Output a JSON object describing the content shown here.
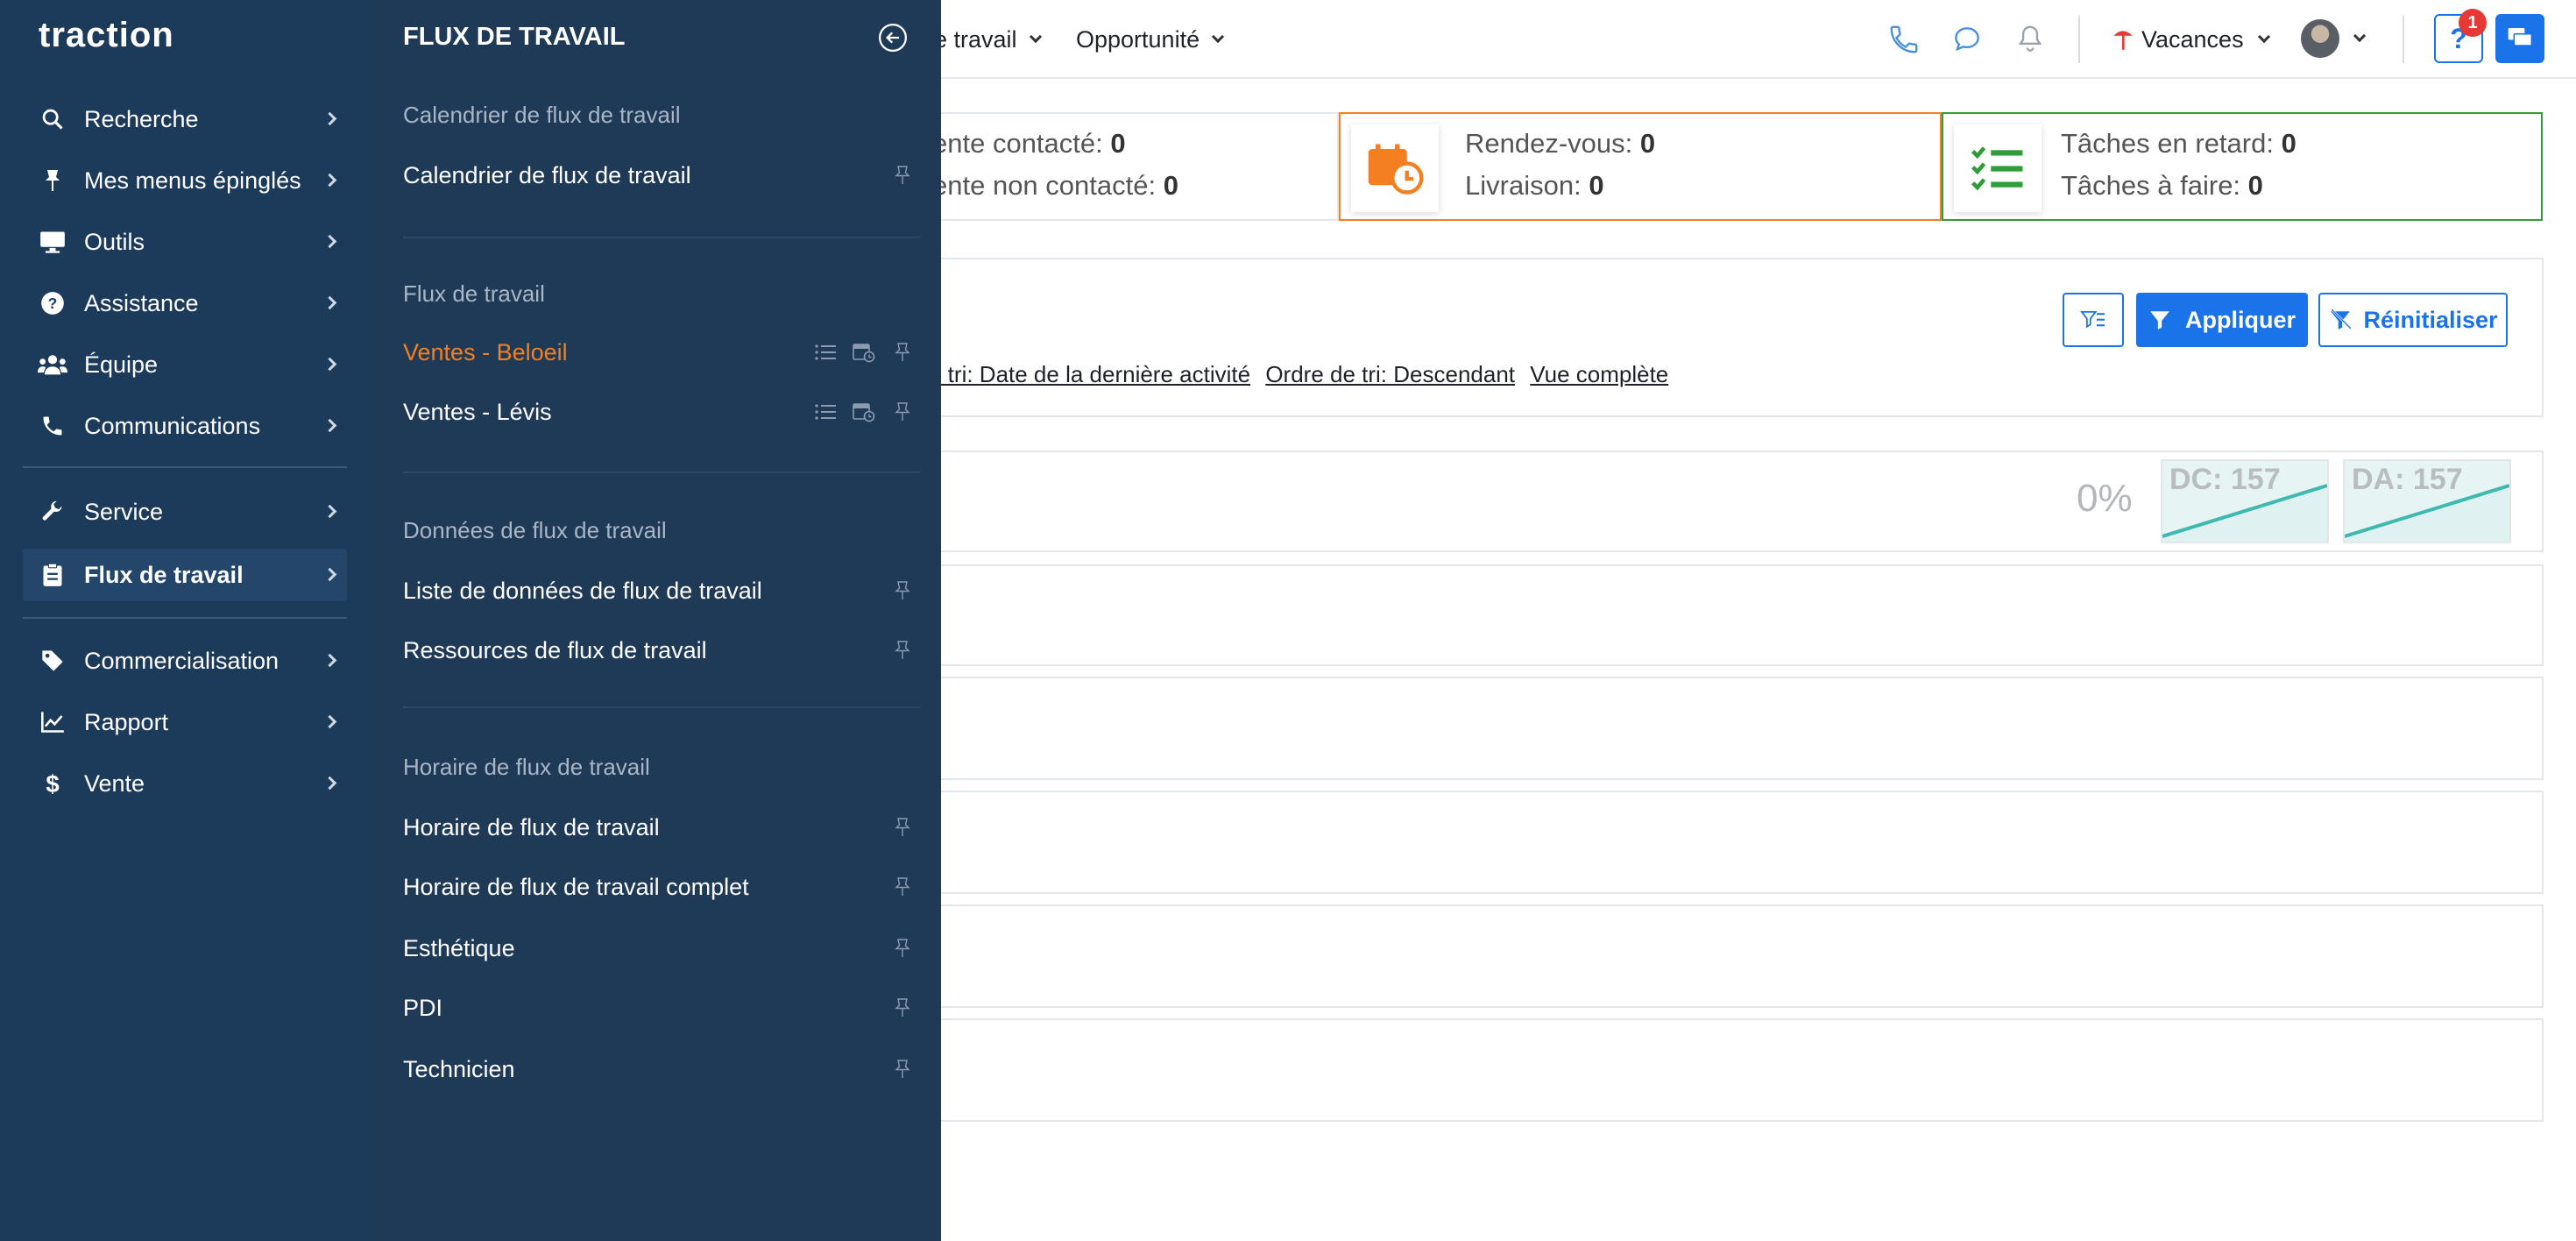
{
  "brand": {
    "logo_text": "traction"
  },
  "topbar": {
    "nav": [
      {
        "label": "e travail"
      },
      {
        "label": "Opportunité"
      }
    ],
    "vacances_label": "Vacances",
    "help_badge_count": "1",
    "help_label": "?"
  },
  "stats": {
    "card1": {
      "line1_label": "ente contacté:",
      "line1_value": "0",
      "line2_label": "ente non contacté:",
      "line2_value": "0"
    },
    "card2": {
      "line1_label": "Rendez-vous:",
      "line1_value": "0",
      "line2_label": "Livraison:",
      "line2_value": "0",
      "accent": "#f47f20"
    },
    "card3": {
      "line1_label": "Tâches en retard:",
      "line1_value": "0",
      "line2_label": "Tâches à faire:",
      "line2_value": "0",
      "accent": "#2e9d3a"
    }
  },
  "filters": {
    "apply_label": "Appliquer",
    "reset_label": "Réinitialiser",
    "sort_field_link": "e tri: Date de la dernière activité",
    "sort_order_link": "Ordre de tri: Descendant",
    "view_link": "Vue complète"
  },
  "summary": {
    "percent": "0%",
    "dc_label": "DC: 157",
    "da_label": "DA: 157"
  },
  "sidebar": {
    "items": [
      {
        "label": "Recherche",
        "icon": "search-icon"
      },
      {
        "label": "Mes menus épinglés",
        "icon": "pin-icon"
      },
      {
        "label": "Outils",
        "icon": "monitor-icon"
      },
      {
        "label": "Assistance",
        "icon": "help-circle-icon"
      },
      {
        "label": "Équipe",
        "icon": "users-icon"
      },
      {
        "label": "Communications",
        "icon": "phone-icon"
      },
      {
        "label": "Service",
        "icon": "wrench-icon"
      },
      {
        "label": "Flux de travail",
        "icon": "clipboard-icon",
        "active": true
      },
      {
        "label": "Commercialisation",
        "icon": "tag-icon"
      },
      {
        "label": "Rapport",
        "icon": "chart-line-icon"
      },
      {
        "label": "Vente",
        "icon": "dollar-icon"
      }
    ]
  },
  "panel": {
    "title": "FLUX DE TRAVAIL",
    "sections": [
      {
        "header": "Calendrier de flux de travail",
        "items": [
          {
            "label": "Calendrier de flux de travail"
          }
        ]
      },
      {
        "header": "Flux de travail",
        "items": [
          {
            "label": "Ventes - Beloeil",
            "selected": true
          },
          {
            "label": "Ventes - Lévis"
          }
        ]
      },
      {
        "header": "Données de flux de travail",
        "items": [
          {
            "label": "Liste de données de flux de travail"
          },
          {
            "label": "Ressources de flux de travail"
          }
        ]
      },
      {
        "header": "Horaire de flux de travail",
        "items": [
          {
            "label": "Horaire de flux de travail"
          },
          {
            "label": "Horaire de flux de travail complet"
          },
          {
            "label": "Esthétique"
          },
          {
            "label": "PDI"
          },
          {
            "label": "Technicien"
          }
        ]
      }
    ]
  },
  "colors": {
    "sidebar_bg": "#1c3a5a",
    "panel_bg": "#1f3a57",
    "primary": "#1a73e8",
    "selected_text": "#f47f20",
    "chart_line": "#3fb9b0"
  }
}
